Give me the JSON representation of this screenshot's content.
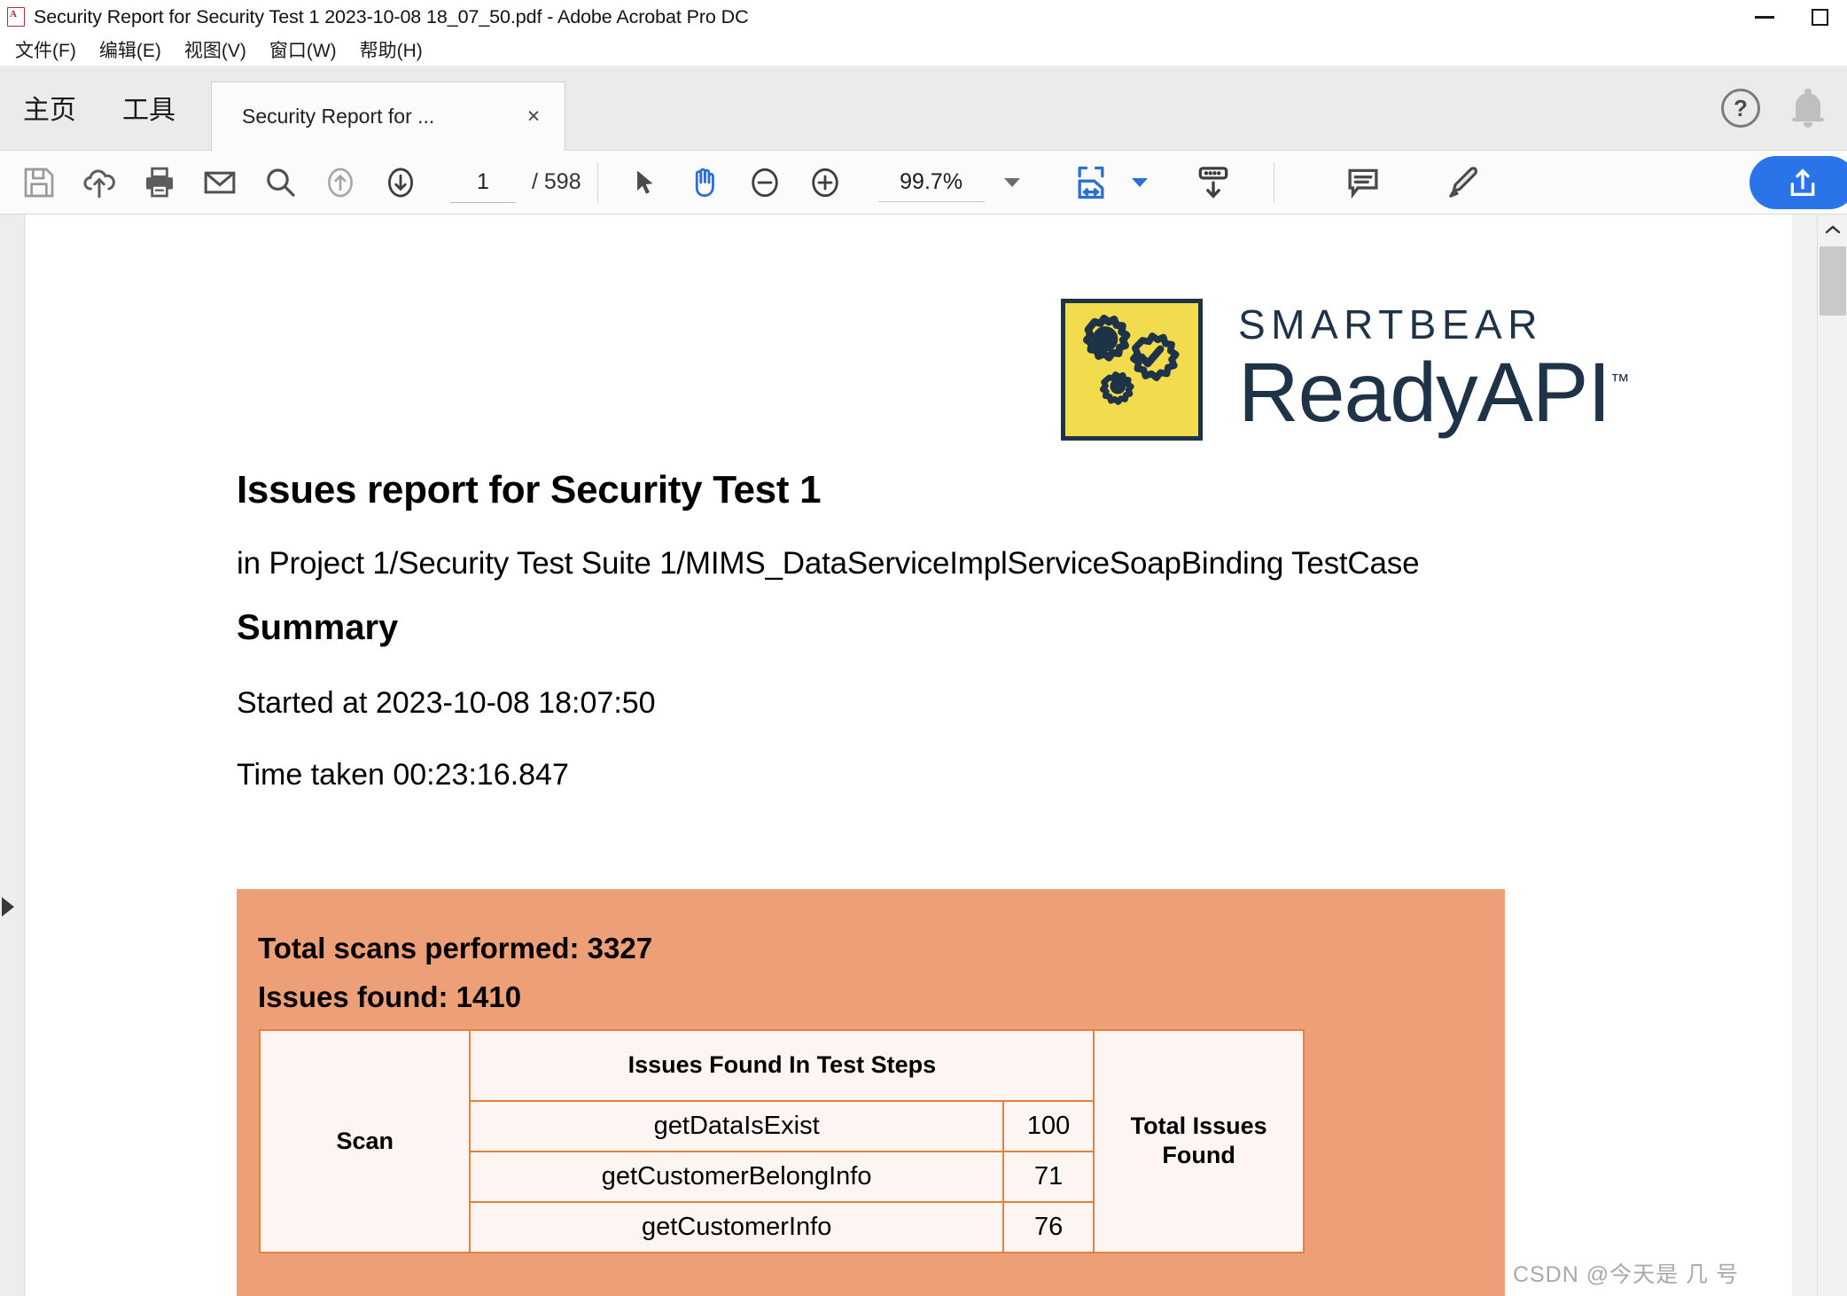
{
  "window": {
    "title": "Security Report for Security Test 1 2023-10-08 18_07_50.pdf - Adobe Acrobat Pro DC",
    "app_icon": "pdf-file-icon",
    "minimize_label": "—",
    "maximize_label": "☐"
  },
  "menubar": {
    "items": [
      {
        "label": "文件(F)",
        "name": "menu-file"
      },
      {
        "label": "编辑(E)",
        "name": "menu-edit"
      },
      {
        "label": "视图(V)",
        "name": "menu-view"
      },
      {
        "label": "窗口(W)",
        "name": "menu-window"
      },
      {
        "label": "帮助(H)",
        "name": "menu-help"
      }
    ]
  },
  "tabstrip": {
    "home_label": "主页",
    "tools_label": "工具",
    "document_tab_label": "Security Report for ...",
    "close_label": "×",
    "help_label": "?",
    "bell_name": "notification-bell-icon"
  },
  "toolbar": {
    "icons": [
      {
        "name": "save-icon",
        "title": "Save"
      },
      {
        "name": "cloud-upload-icon",
        "title": "Save to cloud"
      },
      {
        "name": "print-icon",
        "title": "Print"
      },
      {
        "name": "email-icon",
        "title": "Email"
      },
      {
        "name": "search-icon",
        "title": "Find"
      },
      {
        "name": "previous-page-icon",
        "title": "Previous page"
      },
      {
        "name": "next-page-icon",
        "title": "Next page"
      }
    ],
    "page_current": "1",
    "page_total": "/ 598",
    "select_tool": "select-cursor-icon",
    "hand_tool": "hand-tool-icon",
    "zoom_out": "zoom-out-icon",
    "zoom_in": "zoom-in-icon",
    "zoom_value": "99.7%",
    "fit_width": "fit-width-icon",
    "page_display": "page-scroll-icon",
    "comment": "comment-icon",
    "highlight": "highlighter-icon",
    "share": "share-icon"
  },
  "document": {
    "logo": {
      "brand": "SMARTBEAR",
      "product": "ReadyAPI",
      "trademark": "™",
      "box_color": "#f2db4c",
      "ink_color": "#1f3348"
    },
    "heading": "Issues report for Security Test 1",
    "subheading": "in Project 1/Security Test Suite 1/MIMS_DataServiceImplServiceSoapBinding TestCase",
    "summary_heading": "Summary",
    "started_at": "Started at 2023-10-08 18:07:50",
    "time_taken": "Time taken 00:23:16.847",
    "panel": {
      "background": "#eda077",
      "total_scans": "Total scans performed: 3327",
      "issues_found": "Issues found: 1410"
    },
    "table": {
      "headers": {
        "scan": "Scan",
        "issues_in_steps": "Issues Found In Test Steps",
        "total_issues": "Total Issues Found"
      },
      "rows": [
        {
          "scan": "",
          "step": "getDataIsExist",
          "count": "100",
          "total": ""
        },
        {
          "scan": "",
          "step": "getCustomerBelongInfo",
          "count": "71",
          "total": ""
        },
        {
          "scan": "",
          "step": "getCustomerInfo",
          "count": "76",
          "total": ""
        }
      ]
    }
  },
  "watermark": "CSDN @今天是 几 号",
  "navigation": {
    "expand_pane": "expand-navigation-pane-arrow"
  }
}
